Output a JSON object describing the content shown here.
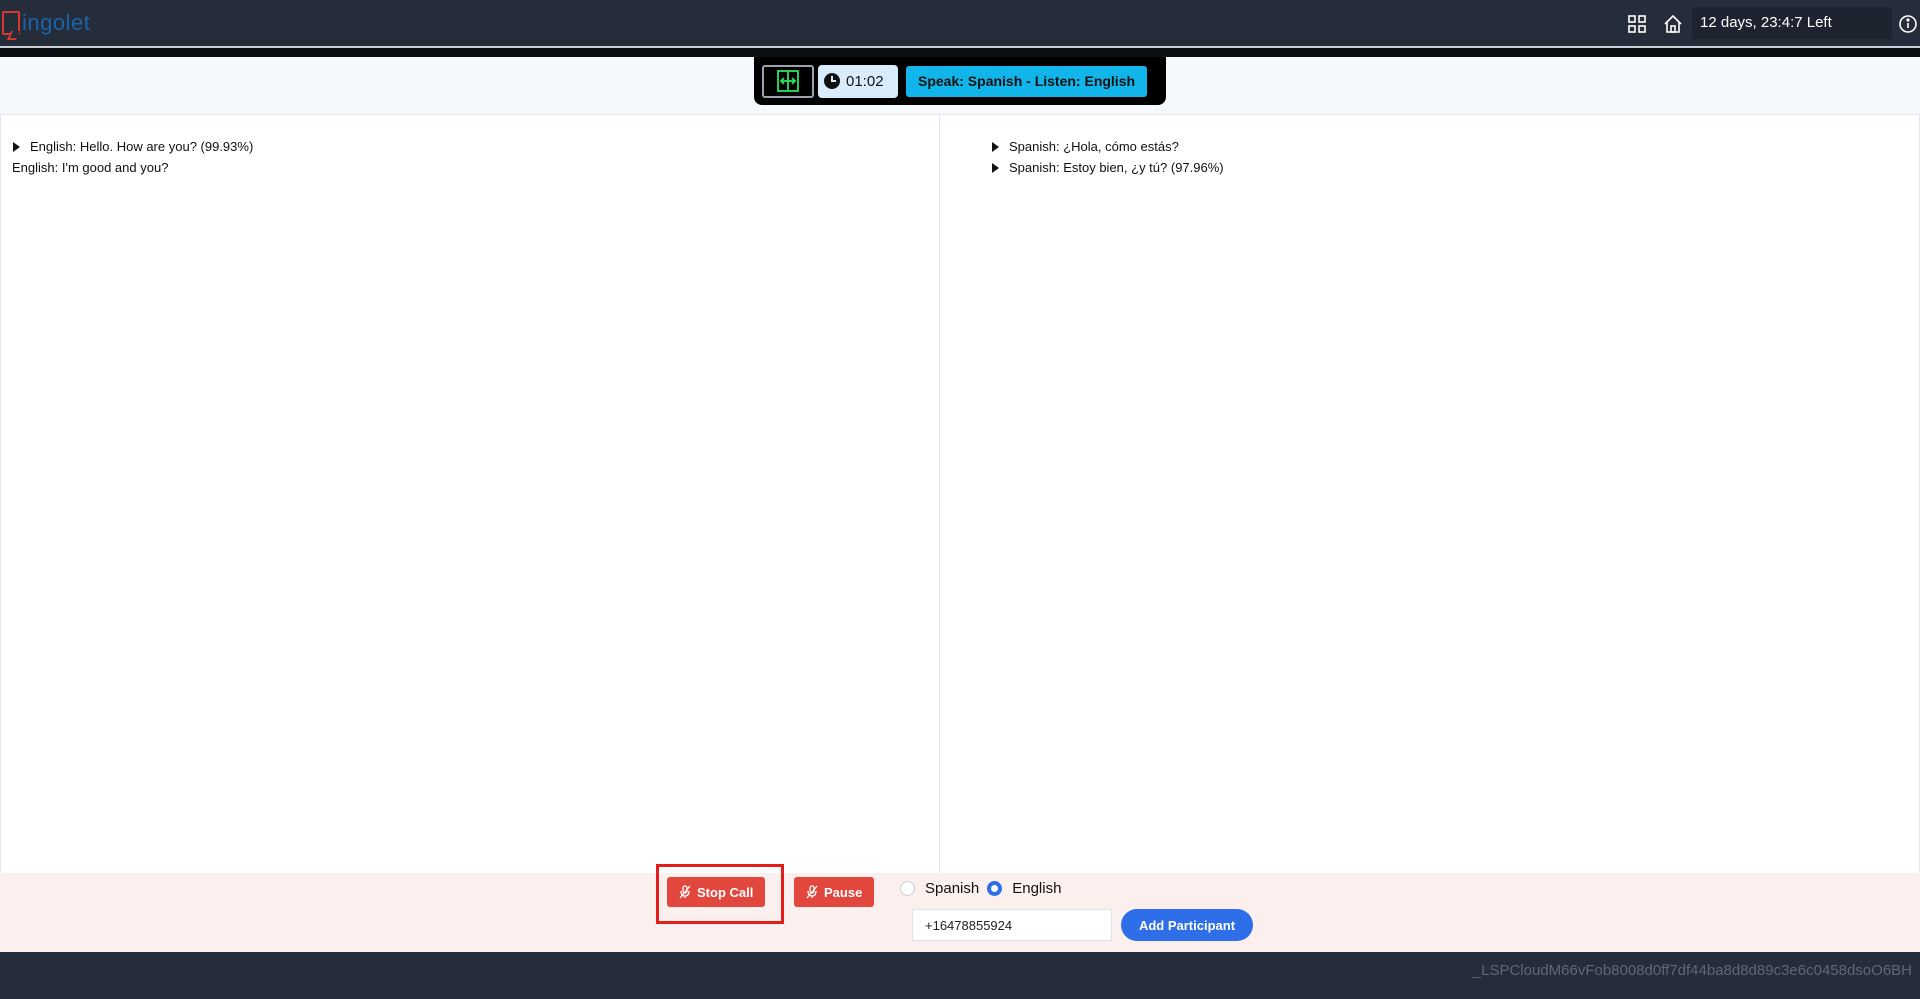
{
  "header": {
    "logo_text": "ingolet",
    "logo_icon": "chat-bubble-icon",
    "apps_icon": "grid-icon",
    "home_icon": "home-icon",
    "time_left": "12 days, 23:4:7 Left",
    "info_icon": "info-icon"
  },
  "callbar": {
    "swap_icon": "swap-screen-icon",
    "timer": "01:02",
    "speak_listen": "Speak: Spanish - Listen: English"
  },
  "transcript": {
    "left": [
      {
        "text": "English: Hello. How are you? (99.93%)",
        "expandable": true
      },
      {
        "text": "English: I'm good and you?",
        "expandable": false
      }
    ],
    "right": [
      {
        "text": "Spanish: ¿Hola, cómo estás?",
        "expandable": true
      },
      {
        "text": "Spanish: Estoy bien, ¿y tú? (97.96%)",
        "expandable": true
      }
    ]
  },
  "controls": {
    "stop_call_label": "Stop Call",
    "pause_label": "Pause",
    "languages": [
      {
        "label": "Spanish",
        "selected": false
      },
      {
        "label": "English",
        "selected": true
      }
    ],
    "phone_value": "+16478855924",
    "add_participant_label": "Add Participant"
  },
  "footer": {
    "session_id": "_LSPCloudM66vFob8008d0ff7df44ba8d8d89c3e6c0458dsoO6BH"
  },
  "colors": {
    "navbar": "#252d3b",
    "accent_cyan": "#12b5ea",
    "danger": "#e2473e",
    "primary": "#2f6ee9"
  }
}
